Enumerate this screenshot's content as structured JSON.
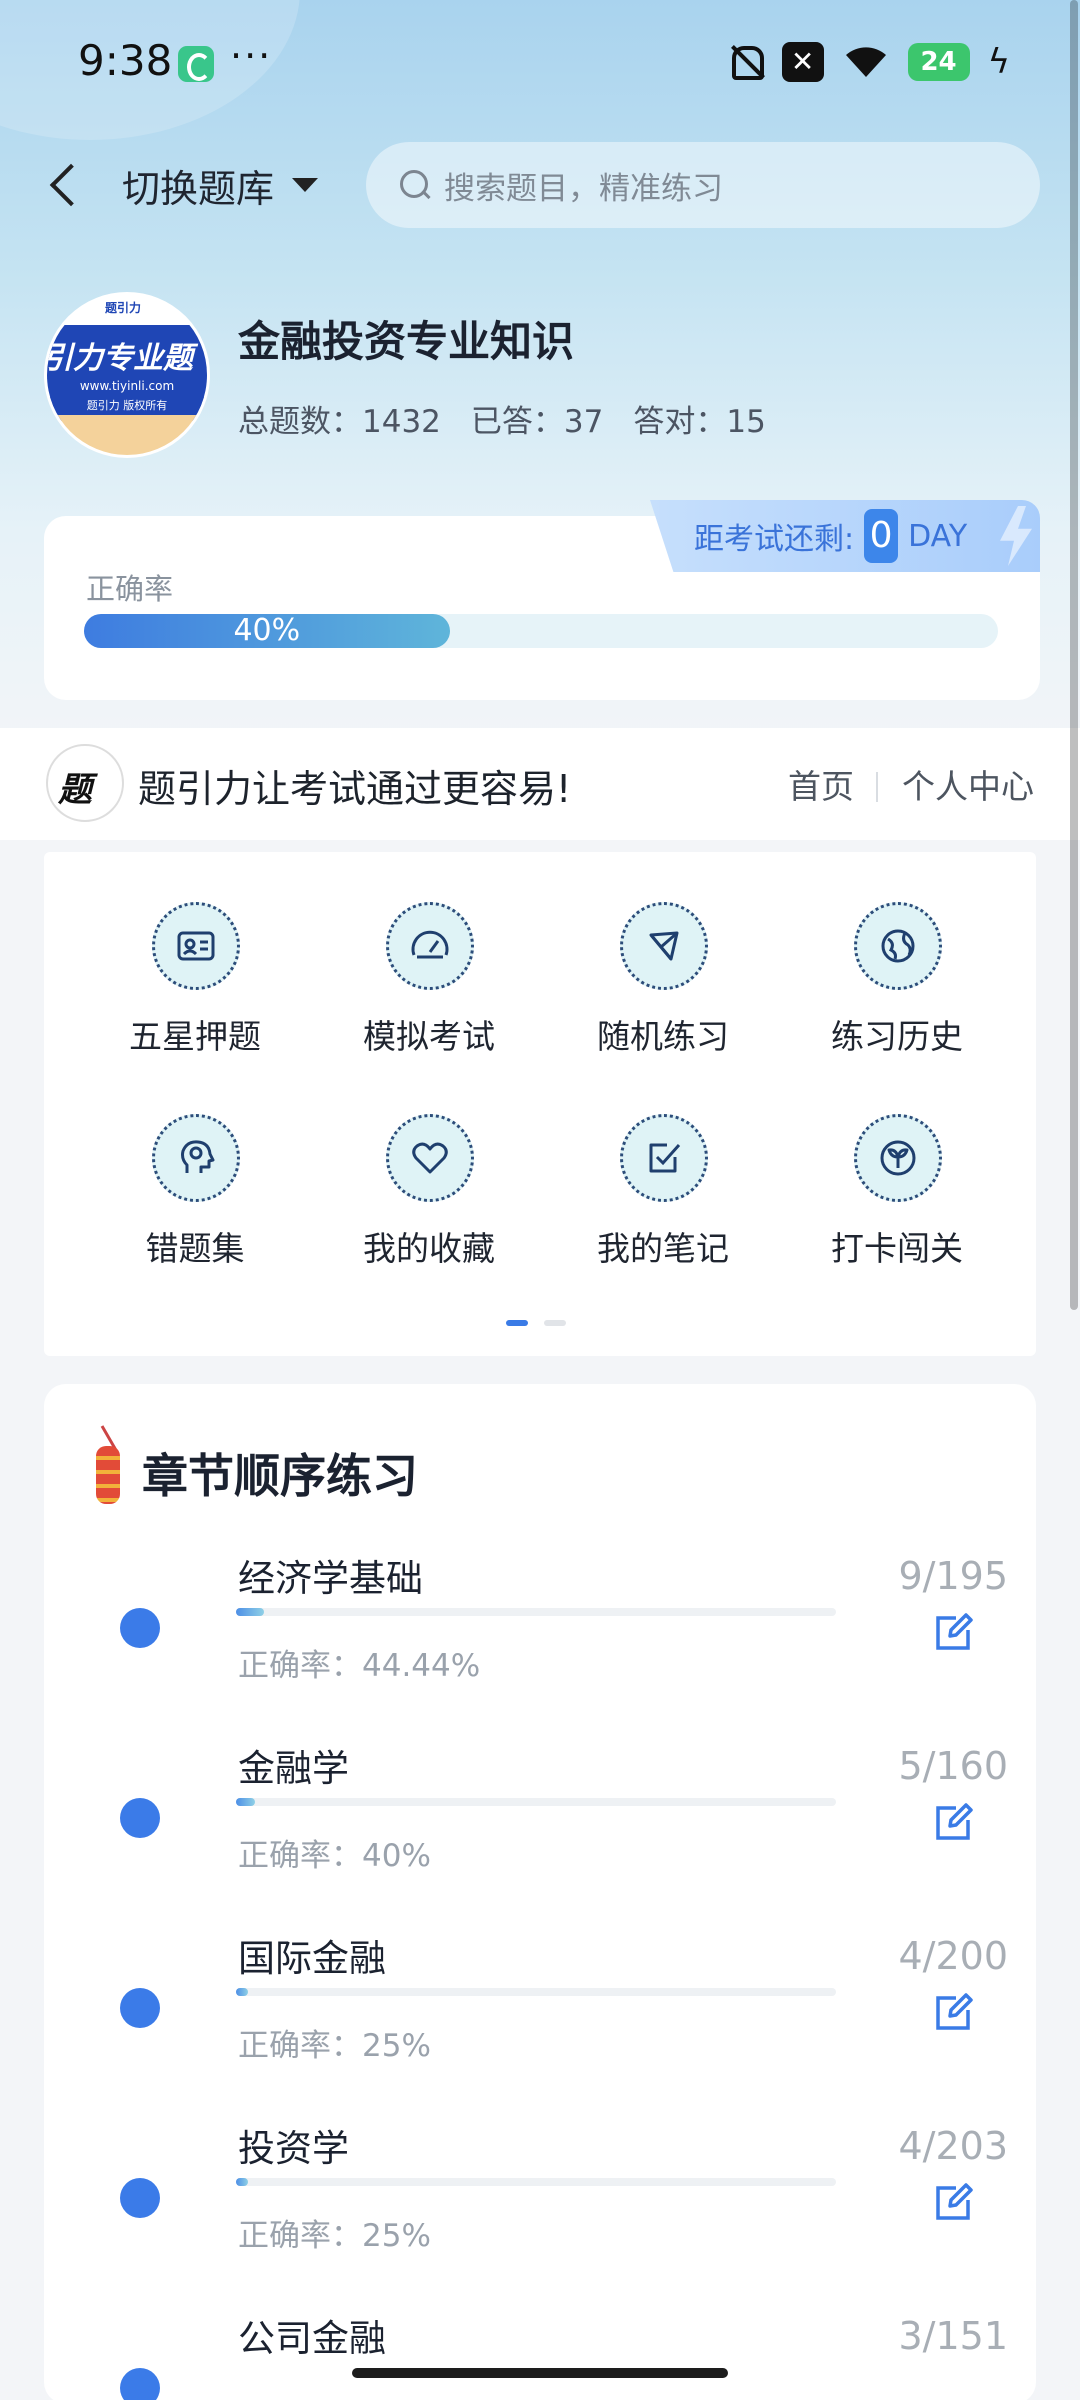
{
  "status": {
    "time": "9:38",
    "dots": "···",
    "battery": "24"
  },
  "nav": {
    "switch_label": "切换题库",
    "search_placeholder": "搜索题目，精准练习"
  },
  "bank": {
    "logo_text": "引力专业题",
    "logo_url": "www.tiyinli.com",
    "logo_caption": "题引力 版权所有",
    "name": "金融投资专业知识",
    "total": "总题数：1432",
    "answered": "已答：37",
    "correct": "答对：15"
  },
  "accuracy": {
    "label": "正确率",
    "value_text": "40%",
    "value": 40,
    "exam_prefix": "距考试还剩:",
    "days": "0",
    "unit": "DAY"
  },
  "banner": {
    "slogan": "题引力让考试通过更容易!",
    "home": "首页",
    "me": "个人中心"
  },
  "functions": [
    {
      "label": "五星押题",
      "icon": "id-card-icon"
    },
    {
      "label": "模拟考试",
      "icon": "speedometer-icon"
    },
    {
      "label": "随机练习",
      "icon": "shuffle-icon"
    },
    {
      "label": "练习历史",
      "icon": "globe-icon"
    },
    {
      "label": "错题集",
      "icon": "head-icon"
    },
    {
      "label": "我的收藏",
      "icon": "heart-icon"
    },
    {
      "label": "我的笔记",
      "icon": "note-check-icon"
    },
    {
      "label": "打卡闯关",
      "icon": "sprout-icon"
    }
  ],
  "chapters": {
    "title": "章节顺序练习",
    "items": [
      {
        "name": "经济学基础",
        "count": "9/195",
        "accuracy": "正确率：44.44%",
        "progress": 0.046
      },
      {
        "name": "金融学",
        "count": "5/160",
        "accuracy": "正确率：40%",
        "progress": 0.031
      },
      {
        "name": "国际金融",
        "count": "4/200",
        "accuracy": "正确率：25%",
        "progress": 0.02
      },
      {
        "name": "投资学",
        "count": "4/203",
        "accuracy": "正确率：25%",
        "progress": 0.02
      },
      {
        "name": "公司金融",
        "count": "3/151",
        "accuracy": "",
        "progress": 0.02
      }
    ]
  }
}
